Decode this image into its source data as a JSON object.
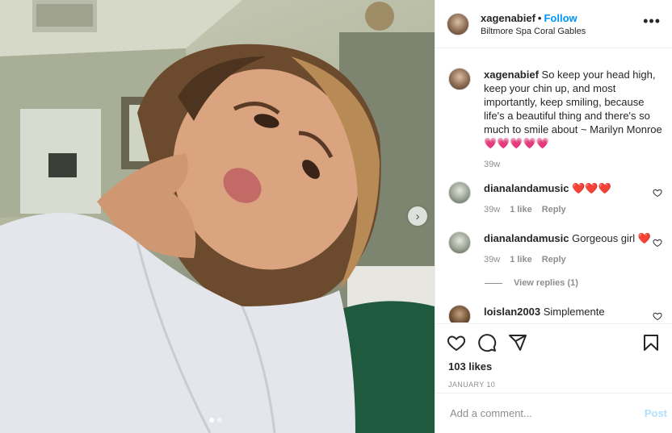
{
  "post": {
    "username": "xagenabief",
    "separator": "•",
    "follow_label": "Follow",
    "location": "Biltmore Spa Coral Gables",
    "more_label": "•••"
  },
  "caption": {
    "username": "xagenabief",
    "text": "So keep your head high, keep your chin up, and most importantly, keep smiling, because life's a beautiful thing and there's so much to smile about ~ Marilyn Monroe 💗💗💗💗💗",
    "time": "39w"
  },
  "comments": [
    {
      "username": "dianalandamusic",
      "text": "❤️❤️❤️",
      "time": "39w",
      "likes": "1 like",
      "reply": "Reply"
    },
    {
      "username": "dianalandamusic",
      "text": "Gorgeous girl ❤️",
      "time": "39w",
      "likes": "1 like",
      "reply": "Reply"
    },
    {
      "username": "loislan2003",
      "text": "Simplemente"
    }
  ],
  "view_replies": "View replies (1)",
  "likes_count": "103 likes",
  "date": "JANUARY 10",
  "add_comment": {
    "placeholder": "Add a comment...",
    "post_label": "Post"
  },
  "icons": [
    "heart-icon",
    "comment-icon",
    "share-icon",
    "bookmark-icon",
    "chevron-right-icon"
  ],
  "colors": {
    "accent": "#0095f6",
    "post_disabled": "#b2dffc",
    "meta": "#8e8e8e"
  }
}
